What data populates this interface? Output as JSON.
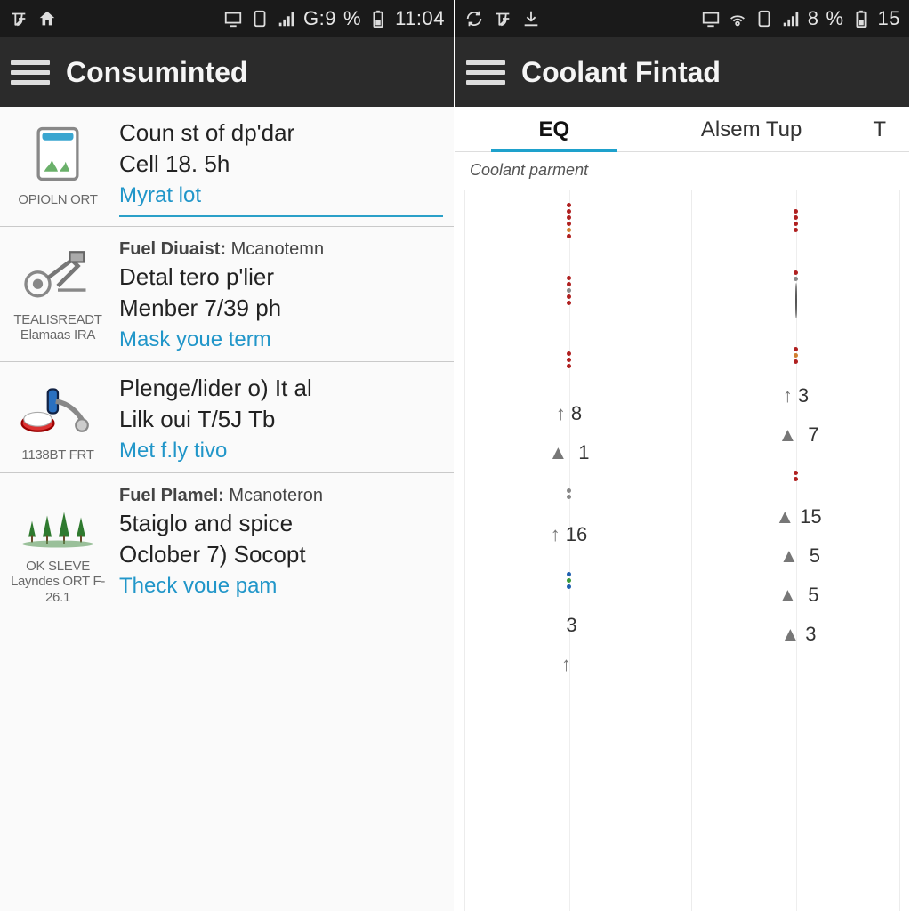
{
  "left": {
    "status": {
      "signal_text": "G:9",
      "pct": "%",
      "time": "11:04"
    },
    "app_title": "Consuminted",
    "rows": [
      {
        "icon_label": "OPIOLN ORT",
        "title": "Coun st of dp'dar",
        "line2": "Cell 18. 5h",
        "link": "Myrat lot"
      },
      {
        "icon_label": "TEALISREADT Elamaas IRA",
        "subtitle_bold": "Fuel Diuaist:",
        "subtitle_small": "Mcanotemn",
        "line2": "Detal tero p'lier",
        "line3": "Menber 7/39 ph",
        "link": "Mask youe term"
      },
      {
        "icon_label": "1138BT FRT",
        "line2": "Plenge/lider o) It al",
        "line3": "Lilk oui T/5J Tb",
        "link": "Met f.ly tivo"
      },
      {
        "icon_label": "OK SLEVE Layndes ORT F-26.1",
        "subtitle_bold": "Fuel Plamel:",
        "subtitle_small": "Mcanoteron",
        "line2": "5taiglo and spice",
        "line3": "Oclober 7) Socopt",
        "link": "Theck voue pam"
      }
    ]
  },
  "right": {
    "status": {
      "signal_text": "8",
      "pct": "%",
      "time": "15"
    },
    "app_title": "Coolant Fintad",
    "tabs": [
      "EQ",
      "Alsem Tup",
      "T"
    ],
    "active_tab": 0,
    "section_caption": "Coolant parment"
  },
  "chart_data": {
    "type": "scatter",
    "title": "Coolant parment",
    "columns": [
      "EQ",
      "Alsem Tup"
    ],
    "series": [
      {
        "name": "EQ",
        "labeled_values": [
          8,
          1,
          16,
          3
        ]
      },
      {
        "name": "Alsem Tup",
        "labeled_values": [
          3,
          7,
          15,
          5,
          5,
          3
        ]
      }
    ],
    "dot_colors": [
      "#b02020",
      "#d08030",
      "#2060b0",
      "#3a9a3a",
      "#d0b020",
      "#888888"
    ]
  }
}
